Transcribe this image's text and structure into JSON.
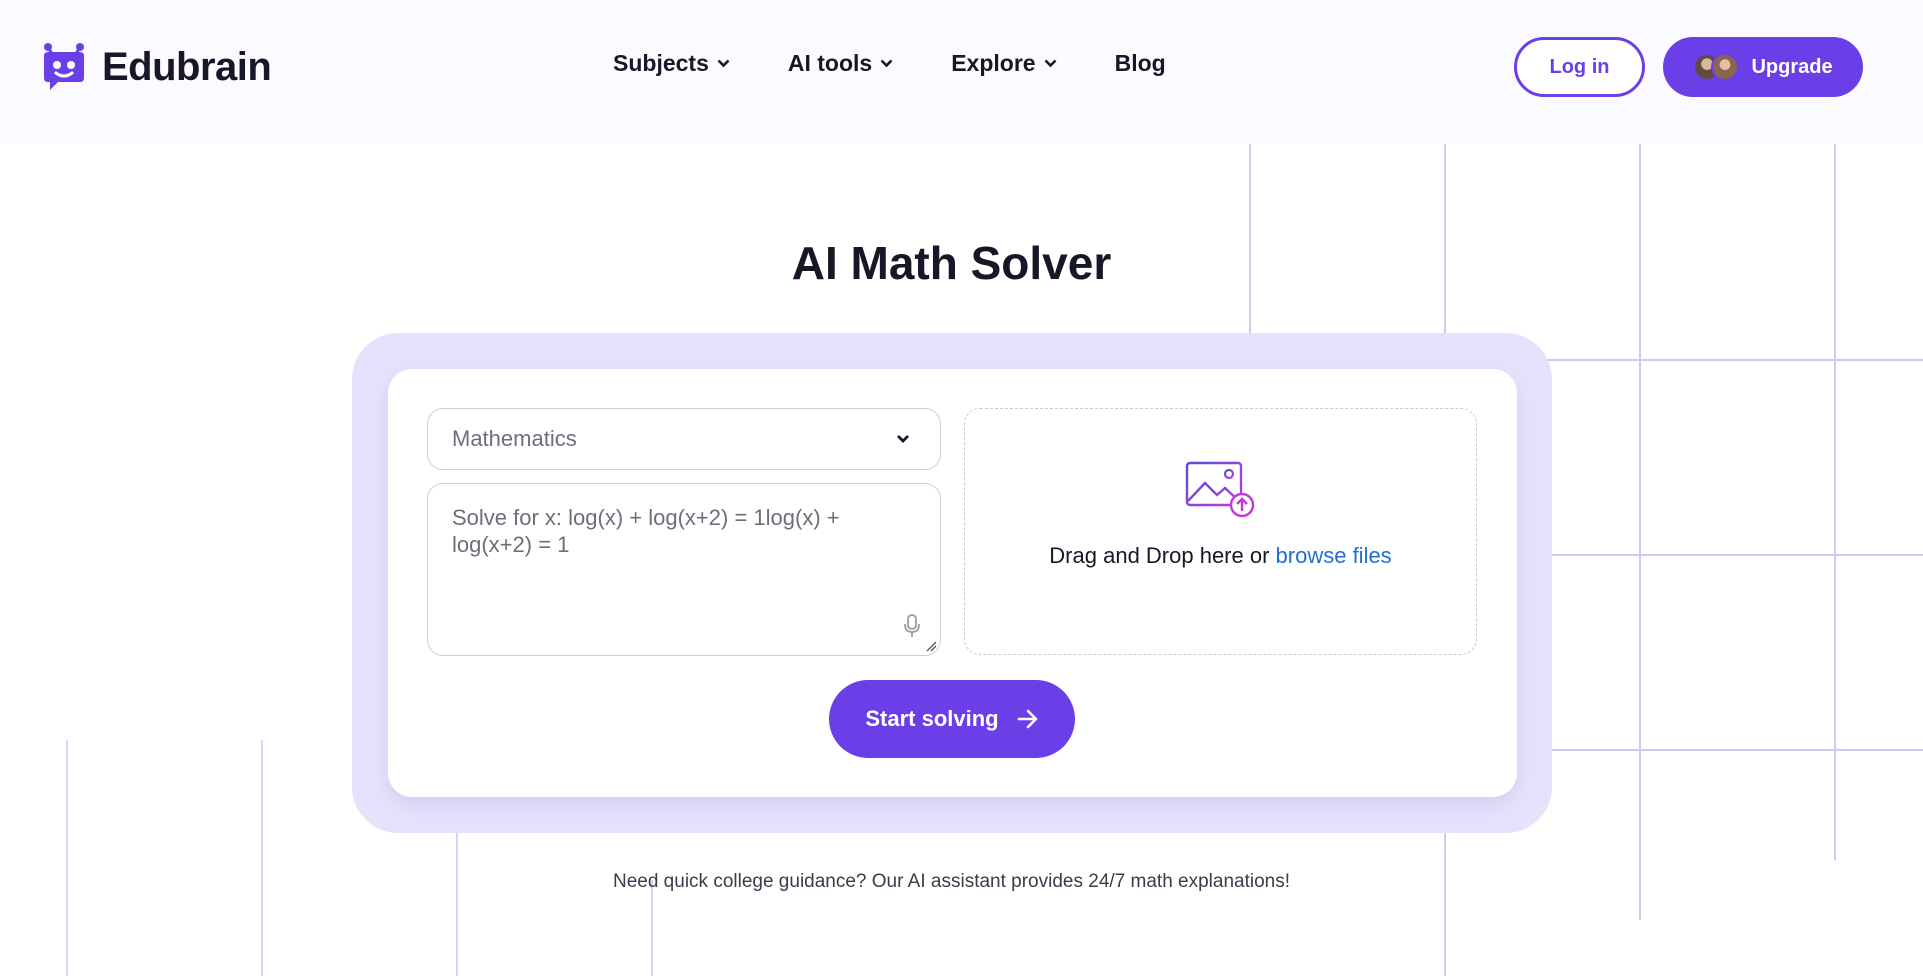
{
  "header": {
    "logo_text": "Edubrain",
    "nav": [
      {
        "label": "Subjects",
        "has_dropdown": true
      },
      {
        "label": "AI tools",
        "has_dropdown": true
      },
      {
        "label": "Explore",
        "has_dropdown": true
      },
      {
        "label": "Blog",
        "has_dropdown": false
      }
    ],
    "login_label": "Log in",
    "upgrade_label": "Upgrade"
  },
  "main": {
    "title": "AI Math Solver",
    "subject_select": {
      "value": "Mathematics"
    },
    "question_input": {
      "value": "Solve for x:  log(x) + log(x+2) = 1log(x) + log(x+2) = 1"
    },
    "upload": {
      "prompt": "Drag and Drop here or ",
      "browse_link": "browse files"
    },
    "start_button_label": "Start solving",
    "footer_note": "Need quick college guidance? Our AI assistant provides 24/7 math explanations!"
  },
  "icons": {
    "logo": "robot-chat-icon",
    "dropdown": "chevron-down-icon",
    "mic": "microphone-icon",
    "upload": "image-upload-icon",
    "arrow": "arrow-right-icon"
  },
  "colors": {
    "brand": "#6b3fe8",
    "link": "#1f6fd4",
    "header_bg": "#fbfaff",
    "card_outer": "#e5e3fb",
    "grid_line": "#c9ccf0"
  }
}
